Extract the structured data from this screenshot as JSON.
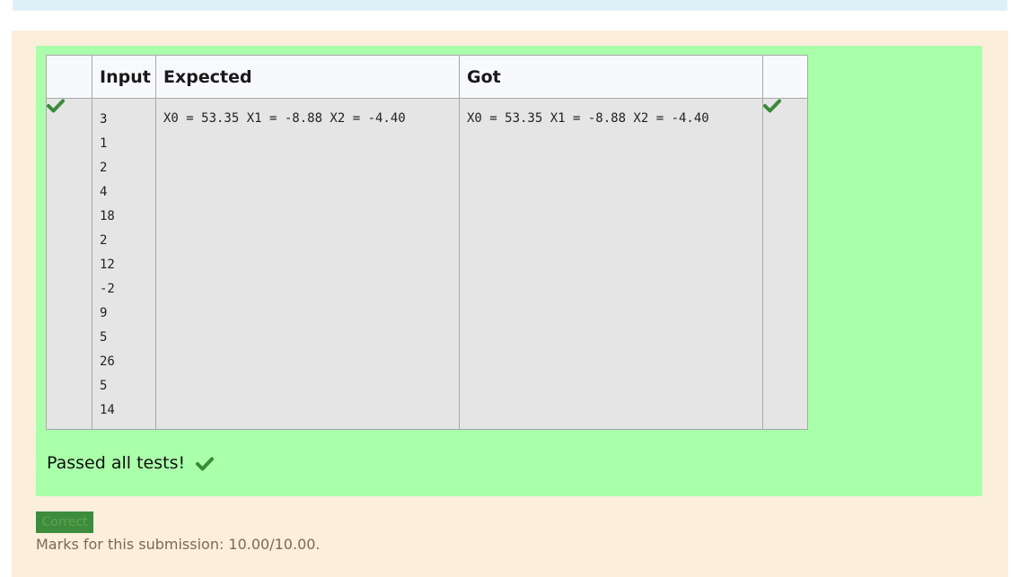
{
  "results_table": {
    "headers": [
      "",
      "Input",
      "Expected",
      "Got",
      ""
    ],
    "rows": [
      {
        "input_lines": [
          "3",
          "1",
          "2",
          "4",
          "18",
          "2",
          "12",
          "-2",
          "9",
          "5",
          "26",
          "5",
          "14"
        ],
        "expected": "X0 = 53.35 X1 = -8.88 X2 = -4.40",
        "got": "X0 = 53.35 X1 = -8.88 X2 = -4.40",
        "status_icon": "check-icon"
      }
    ]
  },
  "summary": {
    "passed_text": "Passed all tests!",
    "icon": "check-icon"
  },
  "grade": {
    "badge": "Correct",
    "marks_text": "Marks for this submission: 10.00/10.00."
  },
  "colors": {
    "result_bg": "#aaffaa",
    "outer_bg": "#fbeedb",
    "check": "#3a8a3a",
    "badge_bg": "#3d8c3d"
  }
}
